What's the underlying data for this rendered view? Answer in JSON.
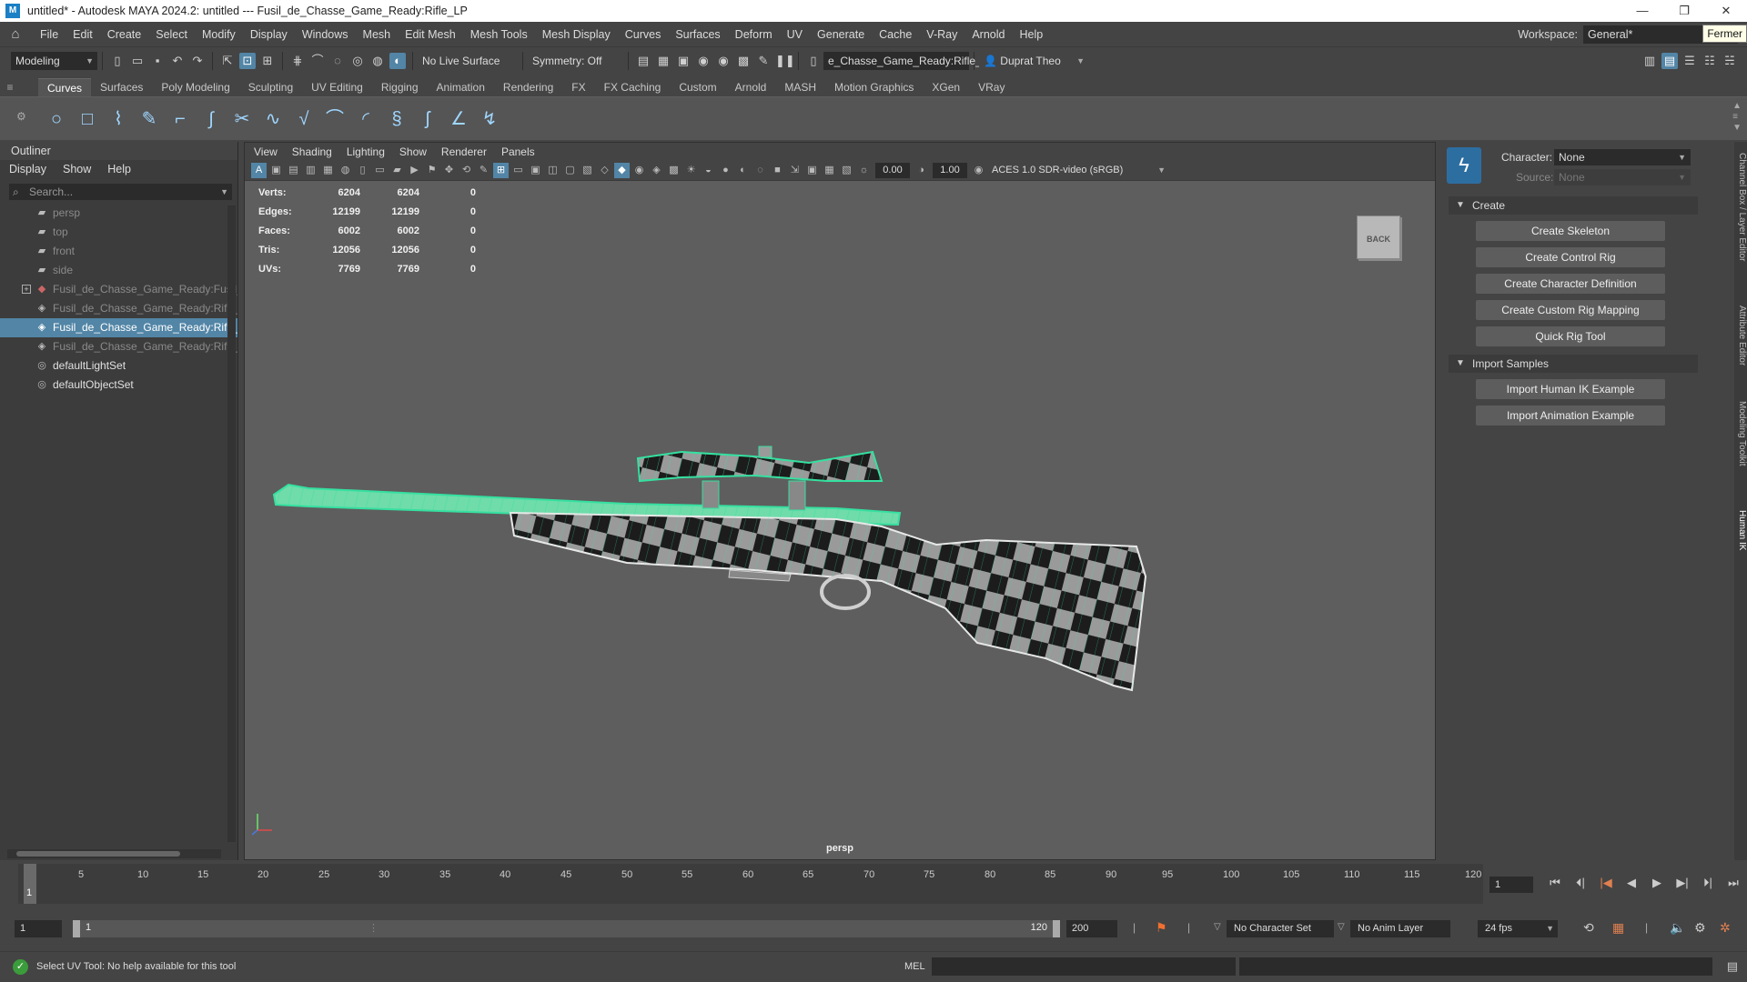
{
  "window": {
    "title": "untitled* - Autodesk MAYA 2024.2: untitled   ---   Fusil_de_Chasse_Game_Ready:Rifle_LP",
    "controls": [
      "—",
      "❐",
      "✕"
    ]
  },
  "menubar": {
    "items": [
      "File",
      "Edit",
      "Create",
      "Select",
      "Modify",
      "Display",
      "Windows",
      "Mesh",
      "Edit Mesh",
      "Mesh Tools",
      "Mesh Display",
      "Curves",
      "Surfaces",
      "Deform",
      "UV",
      "Generate",
      "Cache",
      "V-Ray",
      "Arnold",
      "Help"
    ],
    "workspace_label": "Workspace:",
    "workspace_value": "General*",
    "tooltip": "Fermer"
  },
  "statusline": {
    "mode": "Modeling",
    "live_surface": "No Live Surface",
    "symmetry": "Symmetry: Off",
    "object_field": "e_Chasse_Game_Ready:Rifle_LP",
    "user": "Duprat Theo"
  },
  "shelf": {
    "tabs": [
      "Curves",
      "Surfaces",
      "Poly Modeling",
      "Sculpting",
      "UV Editing",
      "Rigging",
      "Animation",
      "Rendering",
      "FX",
      "FX Caching",
      "Custom",
      "Arnold",
      "MASH",
      "Motion Graphics",
      "XGen",
      "VRay"
    ],
    "selected_tab": "Curves",
    "icons": [
      "circle-curve-icon",
      "square-curve-icon",
      "cv-curve-icon",
      "pencil-curve-icon",
      "ep-curve-icon",
      "bezier-curve-icon",
      "cut-curve-icon",
      "attach-curve-icon",
      "detach-curve-icon",
      "insert-knot-icon",
      "arc-curve-icon",
      "rebuild-curve-icon",
      "offset-curve-icon",
      "fillet-curve-icon",
      "extend-curve-icon"
    ]
  },
  "outliner": {
    "title": "Outliner",
    "menus": [
      "Display",
      "Show",
      "Help"
    ],
    "search_placeholder": "Search...",
    "items": [
      {
        "label": "persp",
        "icon": "camera-icon",
        "state": "dim"
      },
      {
        "label": "top",
        "icon": "camera-icon",
        "state": "dim"
      },
      {
        "label": "front",
        "icon": "camera-icon",
        "state": "dim"
      },
      {
        "label": "side",
        "icon": "camera-icon",
        "state": "dim"
      },
      {
        "label": "Fusil_de_Chasse_Game_Ready:Fusil_L",
        "icon": "group-icon",
        "state": "dim",
        "expand": "+"
      },
      {
        "label": "Fusil_de_Chasse_Game_Ready:Rifle_L",
        "icon": "mesh-icon",
        "state": "dim"
      },
      {
        "label": "Fusil_de_Chasse_Game_Ready:Rifle_L",
        "icon": "mesh-icon",
        "state": "selected"
      },
      {
        "label": "Fusil_de_Chasse_Game_Ready:Rifle_H",
        "icon": "mesh-icon",
        "state": "dim"
      },
      {
        "label": "defaultLightSet",
        "icon": "set-icon",
        "state": "normal"
      },
      {
        "label": "defaultObjectSet",
        "icon": "set-icon",
        "state": "normal"
      }
    ]
  },
  "viewport": {
    "menus": [
      "View",
      "Shading",
      "Lighting",
      "Show",
      "Renderer",
      "Panels"
    ],
    "exposure": "0.00",
    "gamma": "1.00",
    "color_space": "ACES 1.0 SDR-video (sRGB)",
    "hud": [
      {
        "label": "Verts:",
        "a": "6204",
        "b": "6204",
        "c": "0"
      },
      {
        "label": "Edges:",
        "a": "12199",
        "b": "12199",
        "c": "0"
      },
      {
        "label": "Faces:",
        "a": "6002",
        "b": "6002",
        "c": "0"
      },
      {
        "label": "Tris:",
        "a": "12056",
        "b": "12056",
        "c": "0"
      },
      {
        "label": "UVs:",
        "a": "7769",
        "b": "7769",
        "c": "0"
      }
    ],
    "viewcube_label": "BACK",
    "camera": "persp",
    "wire_color": "#35e0a0"
  },
  "humanik": {
    "character_label": "Character:",
    "character_value": "None",
    "source_label": "Source:",
    "source_value": "None",
    "create_section": "Create",
    "create_buttons": [
      "Create Skeleton",
      "Create Control Rig",
      "Create Character Definition",
      "Create Custom Rig Mapping",
      "Quick Rig Tool"
    ],
    "import_section": "Import Samples",
    "import_buttons": [
      "Import Human IK Example",
      "Import Animation Example"
    ],
    "side_tabs": [
      "Channel Box / Layer Editor",
      "Attribute Editor",
      "Modeling Toolkit",
      "Human IK"
    ]
  },
  "timeline": {
    "ticks": [
      "5",
      "10",
      "15",
      "20",
      "25",
      "30",
      "35",
      "40",
      "45",
      "50",
      "55",
      "60",
      "65",
      "70",
      "75",
      "80",
      "85",
      "90",
      "95",
      "100",
      "105",
      "110",
      "115",
      "120"
    ],
    "current_frame": "1",
    "frame_field": "1"
  },
  "range": {
    "start": "1",
    "inner_start": "1",
    "inner_end": "120",
    "end": "200",
    "character_set": "No Character Set",
    "anim_layer": "No Anim Layer",
    "fps": "24 fps"
  },
  "helpline": {
    "message": "Select UV Tool: No help available for this tool",
    "mel_label": "MEL"
  },
  "colors": {
    "selection": "#5285a6",
    "panel": "#444444",
    "viewport_bg": "#5e5e5e"
  }
}
